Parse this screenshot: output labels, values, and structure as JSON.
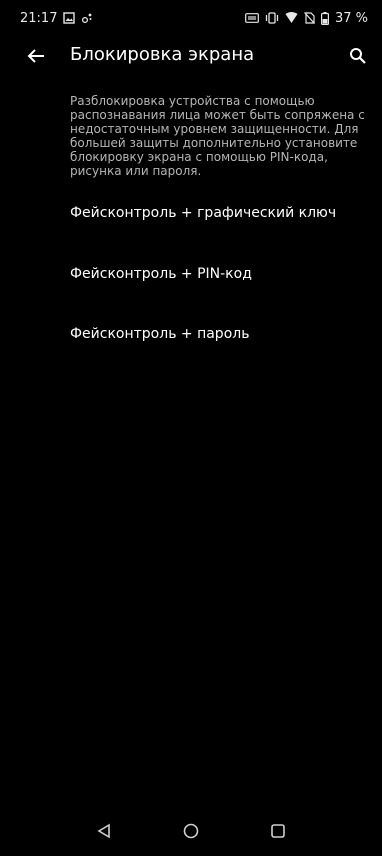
{
  "status": {
    "time": "21:17",
    "battery": "37 %"
  },
  "appbar": {
    "title": "Блокировка экрана"
  },
  "description": "Разблокировка устройства с помощью распознавания лица может быть сопряжена с недостаточным уровнем защищенности. Для большей защиты дополнительно установите блокировку экрана с помощью PIN-кода, рисунка или пароля.",
  "options": [
    "Фейсконтроль + графический ключ",
    "Фейсконтроль + PIN-код",
    "Фейсконтроль + пароль"
  ],
  "icons": {
    "status_left": [
      "image-icon",
      "location-dots-icon"
    ],
    "status_right": [
      "screenshot-icon",
      "vibrate-icon",
      "wifi-icon",
      "no-sim-icon",
      "battery-icon"
    ],
    "app": [
      "back-arrow-icon",
      "search-icon"
    ],
    "nav": [
      "back-triangle-icon",
      "home-circle-icon",
      "recents-square-icon"
    ]
  },
  "colors": {
    "background": "#000000",
    "text_primary": "#ffffff",
    "text_secondary": "#b6b6b6"
  }
}
